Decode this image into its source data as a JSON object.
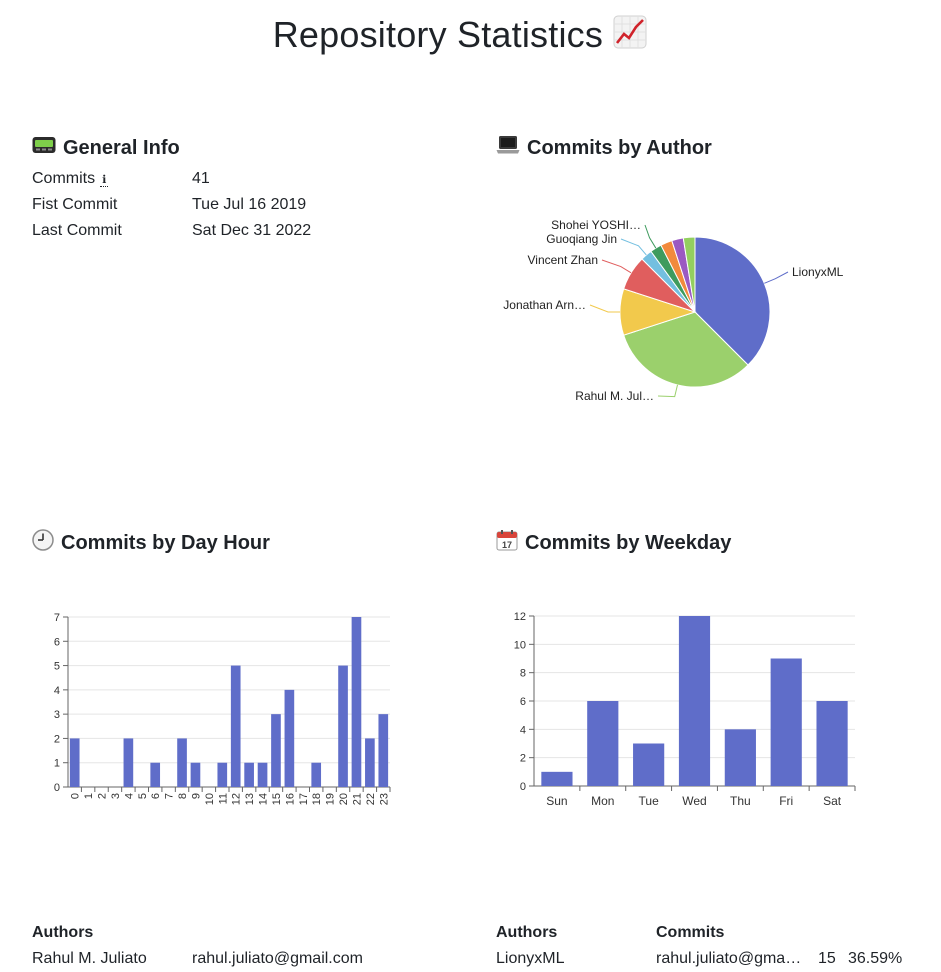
{
  "page": {
    "title": "Repository Statistics",
    "title_icon": "chart-increasing-icon"
  },
  "general_info": {
    "title": "General Info",
    "icon": "pager-icon",
    "rows": [
      {
        "label": "Commits",
        "info_icon": "ℹ",
        "value": "41"
      },
      {
        "label": "Fist Commit",
        "value": "Tue Jul 16 2019"
      },
      {
        "label": "Last Commit",
        "value": "Sat Dec 31 2022"
      }
    ]
  },
  "author_chart": {
    "title": "Commits by Author",
    "icon": "laptop-icon"
  },
  "hour_chart": {
    "title": "Commits by Day Hour",
    "icon": "clock-icon"
  },
  "weekday_chart": {
    "title": "Commits by Weekday",
    "icon": "calendar-icon"
  },
  "colors": {
    "bar": "#5f6dc9",
    "grid": "#e5e5e5",
    "axis": "#666666"
  },
  "chart_data": [
    {
      "type": "pie",
      "labels": [
        "LionyxML",
        "Rahul M. Jul…",
        "Jonathan Arn…",
        "Vincent Zhan",
        "Guoqiang Jin",
        "Shohei YOSHI…",
        "",
        "",
        ""
      ],
      "values": [
        15,
        13,
        4,
        3,
        1,
        1,
        1,
        1,
        1
      ],
      "colors": [
        "#5f6dc9",
        "#9bd06c",
        "#f2c94c",
        "#e05e5e",
        "#73bfe0",
        "#3e9b5e",
        "#f28a3c",
        "#9b59c2",
        "#93cf5f"
      ]
    },
    {
      "type": "bar",
      "categories": [
        "0",
        "1",
        "2",
        "3",
        "4",
        "5",
        "6",
        "7",
        "8",
        "9",
        "10",
        "11",
        "12",
        "13",
        "14",
        "15",
        "16",
        "17",
        "18",
        "19",
        "20",
        "21",
        "22",
        "23"
      ],
      "values": [
        2,
        0,
        0,
        0,
        2,
        0,
        1,
        0,
        2,
        1,
        0,
        1,
        5,
        1,
        1,
        3,
        4,
        0,
        1,
        0,
        5,
        7,
        2,
        3
      ],
      "ylim": [
        0,
        7
      ],
      "yticks": [
        "0",
        "1",
        "2",
        "3",
        "4",
        "5",
        "6",
        "7"
      ]
    },
    {
      "type": "bar",
      "categories": [
        "Sun",
        "Mon",
        "Tue",
        "Wed",
        "Thu",
        "Fri",
        "Sat"
      ],
      "values": [
        1,
        6,
        3,
        12,
        4,
        9,
        6
      ],
      "ylim": [
        0,
        12
      ],
      "yticks": [
        "0",
        "2",
        "4",
        "6",
        "8",
        "10",
        "12"
      ]
    }
  ],
  "authors_table_left": {
    "header": "Authors",
    "rows": [
      {
        "name": "Rahul M. Juliato",
        "email": "rahul.juliato@gmail.com"
      }
    ]
  },
  "authors_table_right": {
    "headers": [
      "Authors",
      "Commits"
    ],
    "rows": [
      {
        "name": "LionyxML",
        "email": "rahul.juliato@gma…",
        "commits": "15",
        "percent": "36.59%"
      }
    ]
  }
}
